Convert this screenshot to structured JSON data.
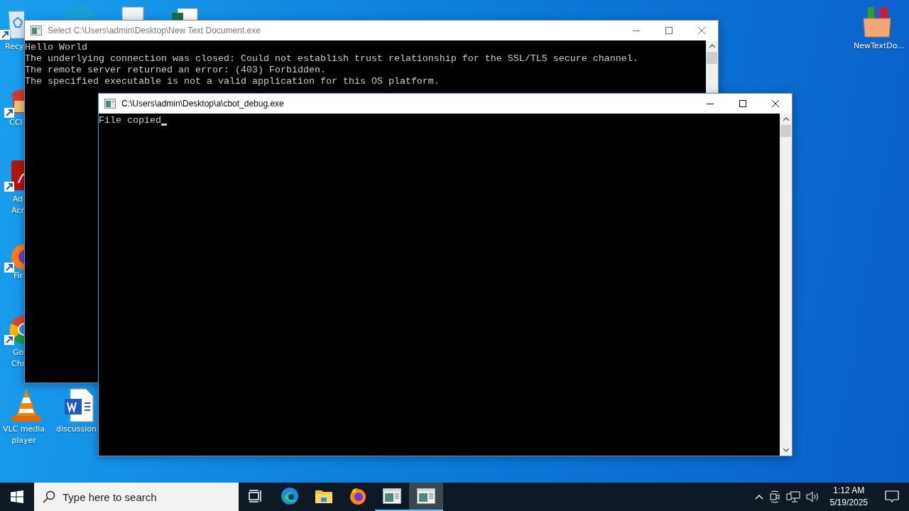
{
  "desktop": {
    "icons": [
      {
        "kind": "recycle",
        "label": "Recy"
      },
      {
        "kind": "ccleaner",
        "label": "CCl"
      },
      {
        "kind": "acrobat",
        "label": "Ad\nAcr"
      },
      {
        "kind": "firefox",
        "label": "Fir"
      },
      {
        "kind": "chrome",
        "label": "Go\nChr"
      },
      {
        "kind": "vlc",
        "label": "VLC media\nplayer"
      },
      {
        "kind": "word",
        "label": "discussion."
      },
      {
        "kind": "winrar",
        "label": "NewTextDo..."
      },
      {
        "kind": "edge"
      },
      {
        "kind": "doc"
      },
      {
        "kind": "excel"
      }
    ]
  },
  "windows": [
    {
      "title": "Select C:\\Users\\admin\\Desktop\\New Text Document.exe",
      "active": false,
      "cursor": false,
      "lines": [
        "Hello World",
        "The underlying connection was closed: Could not establish trust relationship for the SSL/TLS secure channel.",
        "The remote server returned an error: (403) Forbidden.",
        "The specified executable is not a valid application for this OS platform."
      ]
    },
    {
      "title": "C:\\Users\\admin\\Desktop\\a\\cbot_debug.exe",
      "active": true,
      "cursor": true,
      "lines": [
        "File copied"
      ]
    }
  ],
  "taskbar": {
    "search": {
      "placeholder": "Type here to search"
    },
    "apps": [
      {
        "kind": "taskview",
        "selected": false,
        "running": false
      },
      {
        "kind": "edge",
        "selected": false,
        "running": false
      },
      {
        "kind": "explorer",
        "selected": false,
        "running": false
      },
      {
        "kind": "firefox",
        "selected": false,
        "running": false
      },
      {
        "kind": "console",
        "selected": false,
        "running": true
      },
      {
        "kind": "console",
        "selected": true,
        "running": true
      }
    ],
    "clock": {
      "time": "1:12 AM",
      "date": "5/19/2025"
    }
  }
}
